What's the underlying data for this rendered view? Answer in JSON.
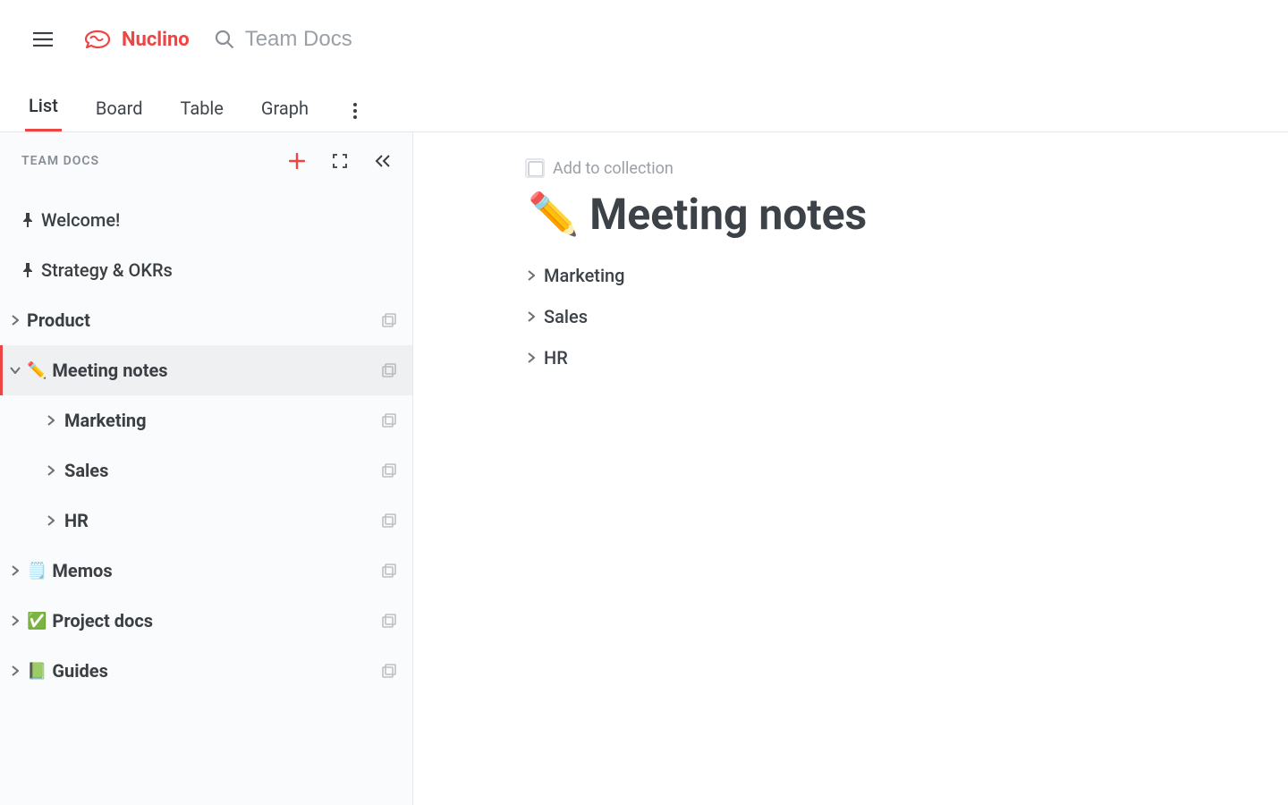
{
  "brand": {
    "name": "Nuclino"
  },
  "search": {
    "placeholder": "Team Docs"
  },
  "views": {
    "tabs": [
      {
        "label": "List",
        "active": true
      },
      {
        "label": "Board",
        "active": false
      },
      {
        "label": "Table",
        "active": false
      },
      {
        "label": "Graph",
        "active": false
      }
    ]
  },
  "sidebar": {
    "title": "TEAM DOCS",
    "pinned": [
      {
        "label": "Welcome!"
      },
      {
        "label": "Strategy & OKRs"
      }
    ],
    "folders": [
      {
        "label": "Product",
        "emoji": "",
        "expanded": false,
        "children": []
      },
      {
        "label": "Meeting notes",
        "emoji": "✏️",
        "expanded": true,
        "selected": true,
        "children": [
          {
            "label": "Marketing"
          },
          {
            "label": "Sales"
          },
          {
            "label": "HR"
          }
        ]
      },
      {
        "label": "Memos",
        "emoji": "🗒️",
        "expanded": false,
        "children": []
      },
      {
        "label": "Project docs",
        "emoji": "✅",
        "expanded": false,
        "children": []
      },
      {
        "label": "Guides",
        "emoji": "📗",
        "expanded": false,
        "children": []
      }
    ]
  },
  "main": {
    "add_to_collection": "Add to collection",
    "title_emoji": "✏️",
    "title": "Meeting notes",
    "toc": [
      {
        "label": "Marketing"
      },
      {
        "label": "Sales"
      },
      {
        "label": "HR"
      }
    ]
  },
  "colors": {
    "accent": "#ef4444"
  }
}
